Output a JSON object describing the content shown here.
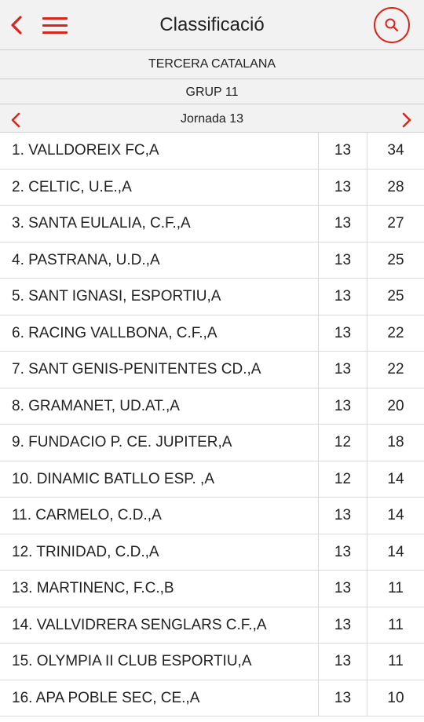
{
  "header": {
    "title": "Classificació",
    "back_icon": "chevron-left-icon",
    "menu_icon": "hamburger-menu-icon",
    "search_icon": "search-icon"
  },
  "competition": {
    "category": "TERCERA CATALANA",
    "group": "GRUP 11",
    "round": "Jornada 13"
  },
  "colors": {
    "accent": "#d9261c",
    "bar_background": "#f2f2f2",
    "divider": "#dadada"
  },
  "standings": [
    {
      "team": "1. VALLDOREIX FC,A",
      "played": "13",
      "points": "34"
    },
    {
      "team": "2. CELTIC, U.E.,A",
      "played": "13",
      "points": "28"
    },
    {
      "team": "3. SANTA EULALIA, C.F.,A",
      "played": "13",
      "points": "27"
    },
    {
      "team": "4. PASTRANA, U.D.,A",
      "played": "13",
      "points": "25"
    },
    {
      "team": "5. SANT IGNASI, ESPORTIU,A",
      "played": "13",
      "points": "25"
    },
    {
      "team": "6. RACING VALLBONA, C.F.,A",
      "played": "13",
      "points": "22"
    },
    {
      "team": "7. SANT GENIS-PENITENTES CD.,A",
      "played": "13",
      "points": "22"
    },
    {
      "team": "8. GRAMANET, UD.AT.,A",
      "played": "13",
      "points": "20"
    },
    {
      "team": "9. FUNDACIO P. CE. JUPITER,A",
      "played": "12",
      "points": "18"
    },
    {
      "team": "10. DINAMIC BATLLO ESP. ,A",
      "played": "12",
      "points": "14"
    },
    {
      "team": "11. CARMELO, C.D.,A",
      "played": "13",
      "points": "14"
    },
    {
      "team": "12. TRINIDAD, C.D.,A",
      "played": "13",
      "points": "14"
    },
    {
      "team": "13. MARTINENC, F.C.,B",
      "played": "13",
      "points": "11"
    },
    {
      "team": "14. VALLVIDRERA SENGLARS C.F.,A",
      "played": "13",
      "points": "11"
    },
    {
      "team": "15. OLYMPIA II CLUB ESPORTIU,A",
      "played": "13",
      "points": "11"
    },
    {
      "team": "16. APA POBLE SEC, CE.,A",
      "played": "13",
      "points": "10"
    }
  ]
}
